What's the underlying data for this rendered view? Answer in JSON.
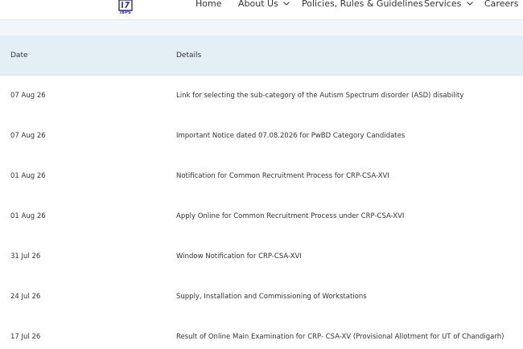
{
  "header": {
    "logo_text": "IBPS",
    "nav": [
      {
        "label": "Home",
        "has_dropdown": false
      },
      {
        "label": "About Us",
        "has_dropdown": true
      },
      {
        "label": "Policies, Rules & Guidelines",
        "has_dropdown": false
      },
      {
        "label": "Services",
        "has_dropdown": true
      },
      {
        "label": "Careers",
        "has_dropdown": false
      }
    ]
  },
  "table": {
    "columns": [
      "Date",
      "Details"
    ],
    "rows": [
      {
        "date": "07 Aug 26",
        "details": "Link for selecting the sub-category of the Autism Spectrum disorder (ASD) disability"
      },
      {
        "date": "07 Aug 26",
        "details": "Important Notice dated 07.08.2026 for PwBD Category Candidates"
      },
      {
        "date": "01 Aug 26",
        "details": "Notification for Common Recruitment Process for CRP-CSA-XVI"
      },
      {
        "date": "01 Aug 26",
        "details": "Apply Online for Common Recruitment Process under CRP-CSA-XVI"
      },
      {
        "date": "31 Jul 26",
        "details": "Window Notification for CRP-CSA-XVI"
      },
      {
        "date": "24 Jul 26",
        "details": "Supply, Installation and Commissioning of Workstations"
      },
      {
        "date": "17 Jul 26",
        "details": "Result of Online Main Examination for CRP- CSA-XV (Provisional Allotment for UT of Chandigarh)"
      }
    ]
  },
  "colors": {
    "header_bg": "#e3eef5",
    "band_bg": "#f2f6f9",
    "logo": "#2a2a8a"
  }
}
